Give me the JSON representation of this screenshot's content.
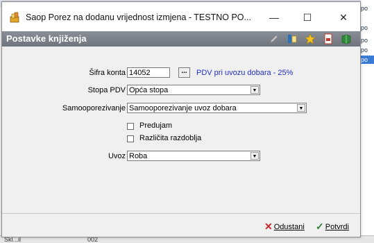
{
  "window": {
    "title": "Saop Porez na dodanu vrijednost izmjena  - TESTNO PO...",
    "minimize_glyph": "—",
    "maximize_glyph": "☐",
    "close_glyph": "✕"
  },
  "header": {
    "title": "Postavke knjiženja"
  },
  "background": {
    "right_rows": [
      "po",
      "po",
      "po",
      "po"
    ],
    "status_left": "Skl...il",
    "status_mid": "002"
  },
  "form": {
    "sifra_konta": {
      "label": "Šifra konta",
      "value": "14052",
      "lookup_label": "...",
      "info": "PDV pri uvozu dobara - 25%"
    },
    "stopa_pdv": {
      "label": "Stopa PDV",
      "value": "Opća stopa"
    },
    "samooporezivanje": {
      "label": "Samooporezivanje",
      "value": "Samooporezivanje uvoz dobara"
    },
    "predujam": {
      "label": "Predujam",
      "checked": false
    },
    "razlicita_razdoblja": {
      "label": "Različita razdoblja",
      "checked": false
    },
    "uvoz": {
      "label": "Uvoz",
      "value": "Roba"
    }
  },
  "footer": {
    "cancel_label": "Odustani",
    "confirm_label": "Potvrdi"
  },
  "colors": {
    "header_bar": "#7d818a",
    "info_text": "#1f2fc8",
    "cancel_icon": "#c62828",
    "confirm_icon": "#2e7d32"
  }
}
